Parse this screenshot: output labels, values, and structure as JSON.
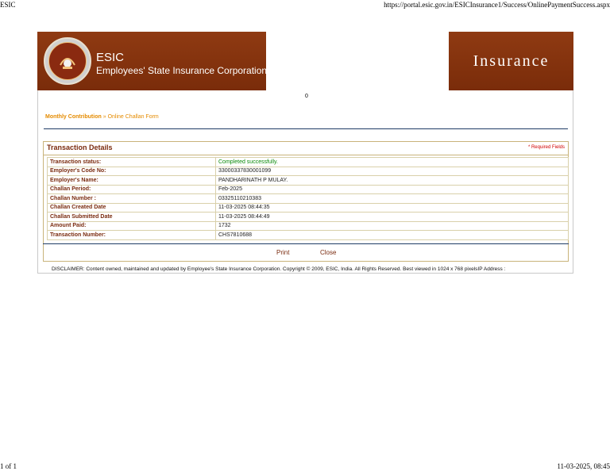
{
  "print_header": {
    "title": "ESIC",
    "url": "https://portal.esic.gov.in/ESICInsurance1/Success/OnlinePaymentSuccess.aspx"
  },
  "print_footer": {
    "page": "1 of 1",
    "datetime": "11-03-2025, 08:45"
  },
  "banner": {
    "brand": "ESIC",
    "org_name": "Employees' State Insurance Corporation",
    "right_text": "Insurance"
  },
  "counter": "0",
  "breadcrumb": {
    "parent": "Monthly Contribution",
    "separator": " » ",
    "current": "Online Challan Form"
  },
  "panel": {
    "title": "Transaction Details",
    "required_note": "* Required Fields"
  },
  "rows": [
    {
      "label": "Transaction status:",
      "value": "Completed successfully."
    },
    {
      "label": "Employer's Code No:",
      "value": "33000337830001099"
    },
    {
      "label": "Employer's Name:",
      "value": "PANDHARINATH P MULAY."
    },
    {
      "label": "Challan Period:",
      "value": "Feb-2025"
    },
    {
      "label": "Challan Number :",
      "value": "03325110210383"
    },
    {
      "label": "Challan Created Date",
      "value": "11-03-2025 08:44:35"
    },
    {
      "label": "Challan Submitted Date",
      "value": "11-03-2025 08:44:49"
    },
    {
      "label": "Amount Paid:",
      "value": "1732"
    },
    {
      "label": "Transaction Number:",
      "value": "CHS7810688"
    }
  ],
  "actions": {
    "print": "Print",
    "close": "Close"
  },
  "disclaimer": "DISCLAIMER: Content owned, maintained and updated by Employee's State Insurance Corporation. Copyright © 2009, ESIC, India. All Rights Reserved. Best viewed in 1024 x 768 pixelsIP Address :",
  "colors": {
    "banner": "#8f3a12",
    "label": "#7a2b0f",
    "breadcrumb": "#e58b00",
    "status_ok": "#0a8a0a",
    "required": "#d00000"
  }
}
